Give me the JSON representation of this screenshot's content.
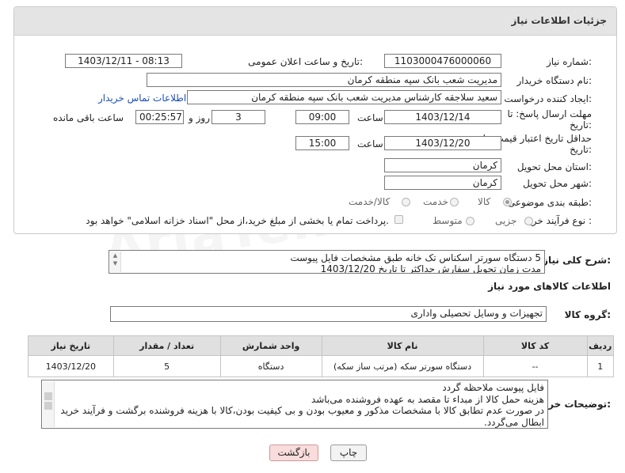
{
  "header": {
    "title": "جزئیات اطلاعات نیاز"
  },
  "form": {
    "need_number_label": "شماره نیاز:",
    "need_number": "1103000476000060",
    "announce_label": "تاریخ و ساعت اعلان عمومی:",
    "announce_value": "1403/12/11 - 08:13",
    "buyer_org_label": "نام دستگاه خریدار:",
    "buyer_org": "مدیریت شعب بانک سپه منطقه کرمان",
    "creator_label": "ایجاد کننده درخواست:",
    "creator": "سعید سلاجقه کارشناس مدیریت شعب بانک سپه منطقه کرمان",
    "contact_link": "اطلاعات تماس خریدار",
    "deadline_label": "مهلت ارسال پاسخ: تا",
    "deadline_label2": "تاریخ:",
    "deadline_date": "1403/12/14",
    "time_label": "ساعت",
    "deadline_time": "09:00",
    "days_value": "3",
    "days_label": "روز و",
    "remaining_time": "00:25:57",
    "remaining_label": "ساعت باقی مانده",
    "validity_label": "حداقل تاریخ اعتبار قیمت: تا",
    "validity_label2": "تاریخ:",
    "validity_date": "1403/12/20",
    "validity_time_label": "ساعت",
    "validity_time": "15:00",
    "province_label": "استان محل تحویل:",
    "province": "کرمان",
    "city_label": "شهر محل تحویل:",
    "city": "کرمان",
    "category_label": "طبقه بندی موضوعی:",
    "category_options": [
      "کالا",
      "خدمت",
      "کالا/خدمت"
    ],
    "process_label": "نوع فرآیند خرید :",
    "process_options": [
      "جزیی",
      "متوسط"
    ],
    "payment_note": "پرداخت تمام یا بخشی از مبلغ خرید،از محل \"اسناد خزانه اسلامی\" خواهد بود."
  },
  "summary": {
    "label": "شرح کلی نیاز:",
    "line1": "5 دستگاه سورتر اسکناس تک خانه طبق مشخصات فایل پیوست",
    "line2": "مدت زمان تحویل سفارش حداکثر تا تاریخ 1403/12/20"
  },
  "goods": {
    "section_title": "اطلاعات کالاهای مورد نیاز",
    "group_label": "گروه کالا:",
    "group_value": "تجهیزات و وسایل تحصیلی واداری"
  },
  "table": {
    "headers": [
      "ردیف",
      "کد کالا",
      "نام کالا",
      "واحد شمارش",
      "تعداد / مقدار",
      "تاریخ نیاز"
    ],
    "rows": [
      {
        "row": "1",
        "code": "--",
        "name": "دستگاه سورتر سکه (مرتب ساز سکه)",
        "unit": "دستگاه",
        "qty": "5",
        "date": "1403/12/20"
      }
    ]
  },
  "buyer_notes": {
    "label": "توضیحات خریدار:",
    "lines": [
      "فایل پیوست ملاحظه گردد",
      "هزینه حمل کالا از مبداء تا مقصد به عهده فروشنده می‌باشد",
      "در صورت عدم تطابق کالا با مشخصات مذکور و معیوب بودن و بی کیفیت بودن،کالا با هزینه فروشنده برگشت و فرآیند خرید",
      "ابطال می‌گردد."
    ]
  },
  "buttons": {
    "print": "چاپ",
    "back": "بازگشت"
  },
  "colors": {
    "header_bg": "#e4e4e4",
    "link": "#1a4fb5",
    "back_button_bg": "#f9dcdc"
  }
}
